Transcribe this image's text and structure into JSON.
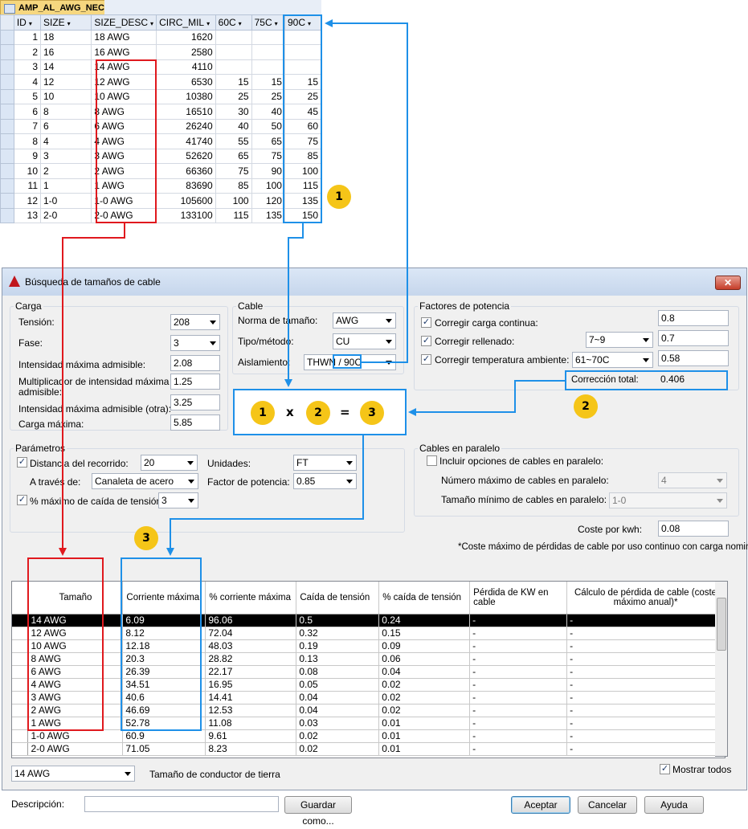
{
  "access": {
    "tab_title": "AMP_AL_AWG_NEC",
    "columns": [
      "ID",
      "SIZE",
      "SIZE_DESC",
      "CIRC_MIL",
      "60C",
      "75C",
      "90C"
    ],
    "rows": [
      [
        "1",
        "18",
        "18 AWG",
        "1620",
        "",
        "",
        ""
      ],
      [
        "2",
        "16",
        "16 AWG",
        "2580",
        "",
        "",
        ""
      ],
      [
        "3",
        "14",
        "14 AWG",
        "4110",
        "",
        "",
        ""
      ],
      [
        "4",
        "12",
        "12 AWG",
        "6530",
        "15",
        "15",
        "15"
      ],
      [
        "5",
        "10",
        "10 AWG",
        "10380",
        "25",
        "25",
        "25"
      ],
      [
        "6",
        "8",
        "8 AWG",
        "16510",
        "30",
        "40",
        "45"
      ],
      [
        "7",
        "6",
        "6 AWG",
        "26240",
        "40",
        "50",
        "60"
      ],
      [
        "8",
        "4",
        "4 AWG",
        "41740",
        "55",
        "65",
        "75"
      ],
      [
        "9",
        "3",
        "3 AWG",
        "52620",
        "65",
        "75",
        "85"
      ],
      [
        "10",
        "2",
        "2 AWG",
        "66360",
        "75",
        "90",
        "100"
      ],
      [
        "11",
        "1",
        "1 AWG",
        "83690",
        "85",
        "100",
        "115"
      ],
      [
        "12",
        "1-0",
        "1-0 AWG",
        "105600",
        "100",
        "120",
        "135"
      ],
      [
        "13",
        "2-0",
        "2-0 AWG",
        "133100",
        "115",
        "135",
        "150"
      ]
    ]
  },
  "dialog": {
    "title": "Búsqueda de tamaños de cable",
    "close_label": "✕",
    "carga": {
      "legend": "Carga",
      "tension_label": "Tensión:",
      "tension_value": "208",
      "fase_label": "Fase:",
      "fase_value": "3",
      "imax_label": "Intensidad máxima admisible:",
      "imax_value": "2.08",
      "mult_label_1": "Multiplicador de intensidad máxima",
      "mult_label_2": "admisible:",
      "mult_value": "1.25",
      "imax_otra_label": "Intensidad máxima admisible (otra):",
      "imax_otra_value": "3.25",
      "carga_max_label": "Carga máxima:",
      "carga_max_value": "5.85"
    },
    "cable": {
      "legend": "Cable",
      "norma_label": "Norma de tamaño:",
      "norma_value": "AWG",
      "tipo_label": "Tipo/método:",
      "tipo_value": "CU",
      "aislamiento_label": "Aislamiento:",
      "aislamiento_value": "THWN / 90C"
    },
    "factores": {
      "legend": "Factores de potencia",
      "carga_cont_label": "Corregir carga continua:",
      "carga_cont_value": "0.8",
      "rellenado_label": "Corregir rellenado:",
      "rellenado_combo": "7~9",
      "rellenado_value": "0.7",
      "temp_label": "Corregir temperatura ambiente:",
      "temp_combo": "61~70C",
      "temp_value": "0.58",
      "total_label": "Corrección total:",
      "total_value": "0.406"
    },
    "parametros": {
      "legend": "Parámetros",
      "distancia_label": "Distancia del recorrido:",
      "distancia_value": "20",
      "unidades_label": "Unidades:",
      "unidades_value": "FT",
      "traves_label": "A través de:",
      "traves_value": "Canaleta de acero",
      "fp_label": "Factor de potencia:",
      "fp_value": "0.85",
      "caida_label": "% máximo de caída de tensión:",
      "caida_value": "3"
    },
    "paralelo": {
      "legend": "Cables en paralelo",
      "incluir_label": "Incluir opciones de cables en paralelo:",
      "num_label": "Número máximo de cables en paralelo:",
      "num_value": "4",
      "tam_label": "Tamaño mínimo de cables en paralelo:",
      "tam_value": "1-0"
    },
    "coste_kwh_label": "Coste por kwh:",
    "coste_kwh_value": "0.08",
    "coste_note": "*Coste máximo de pérdidas de cable por uso continuo con carga nominal",
    "result_columns": [
      "Tamaño",
      "Corriente máxima",
      "% corriente máxima",
      "Caída de tensión",
      "% caída de tensión",
      "Pérdida de KW en cable",
      "Cálculo de pérdida de cable (coste máximo anual)*"
    ],
    "result_rows": [
      [
        "14 AWG",
        "6.09",
        "96.06",
        "0.5",
        "0.24",
        "-",
        "-"
      ],
      [
        "12 AWG",
        "8.12",
        "72.04",
        "0.32",
        "0.15",
        "-",
        "-"
      ],
      [
        "10 AWG",
        "12.18",
        "48.03",
        "0.19",
        "0.09",
        "-",
        "-"
      ],
      [
        "8 AWG",
        "20.3",
        "28.82",
        "0.13",
        "0.06",
        "-",
        "-"
      ],
      [
        "6 AWG",
        "26.39",
        "22.17",
        "0.08",
        "0.04",
        "-",
        "-"
      ],
      [
        "4 AWG",
        "34.51",
        "16.95",
        "0.05",
        "0.02",
        "-",
        "-"
      ],
      [
        "3 AWG",
        "40.6",
        "14.41",
        "0.04",
        "0.02",
        "-",
        "-"
      ],
      [
        "2 AWG",
        "46.69",
        "12.53",
        "0.04",
        "0.02",
        "-",
        "-"
      ],
      [
        "1 AWG",
        "52.78",
        "11.08",
        "0.03",
        "0.01",
        "-",
        "-"
      ],
      [
        "1-0 AWG",
        "60.9",
        "9.61",
        "0.02",
        "0.01",
        "-",
        "-"
      ],
      [
        "2-0 AWG",
        "71.05",
        "8.23",
        "0.02",
        "0.01",
        "-",
        "-"
      ]
    ],
    "tierra_value": "14 AWG",
    "tierra_label": "Tamaño de conductor de tierra",
    "mostrar_label": "Mostrar todos",
    "descripcion_label": "Descripción:",
    "guardar_label": "Guardar como...",
    "aceptar_label": "Aceptar",
    "cancelar_label": "Cancelar",
    "ayuda_label": "Ayuda"
  },
  "annotations": {
    "badge_1": "1",
    "badge_2": "2",
    "badge_3": "3",
    "eq_x": "x",
    "eq_eq": "=",
    "colors": {
      "red": "#e0191e",
      "blue": "#1e90e8",
      "badge": "#f5c518"
    }
  }
}
